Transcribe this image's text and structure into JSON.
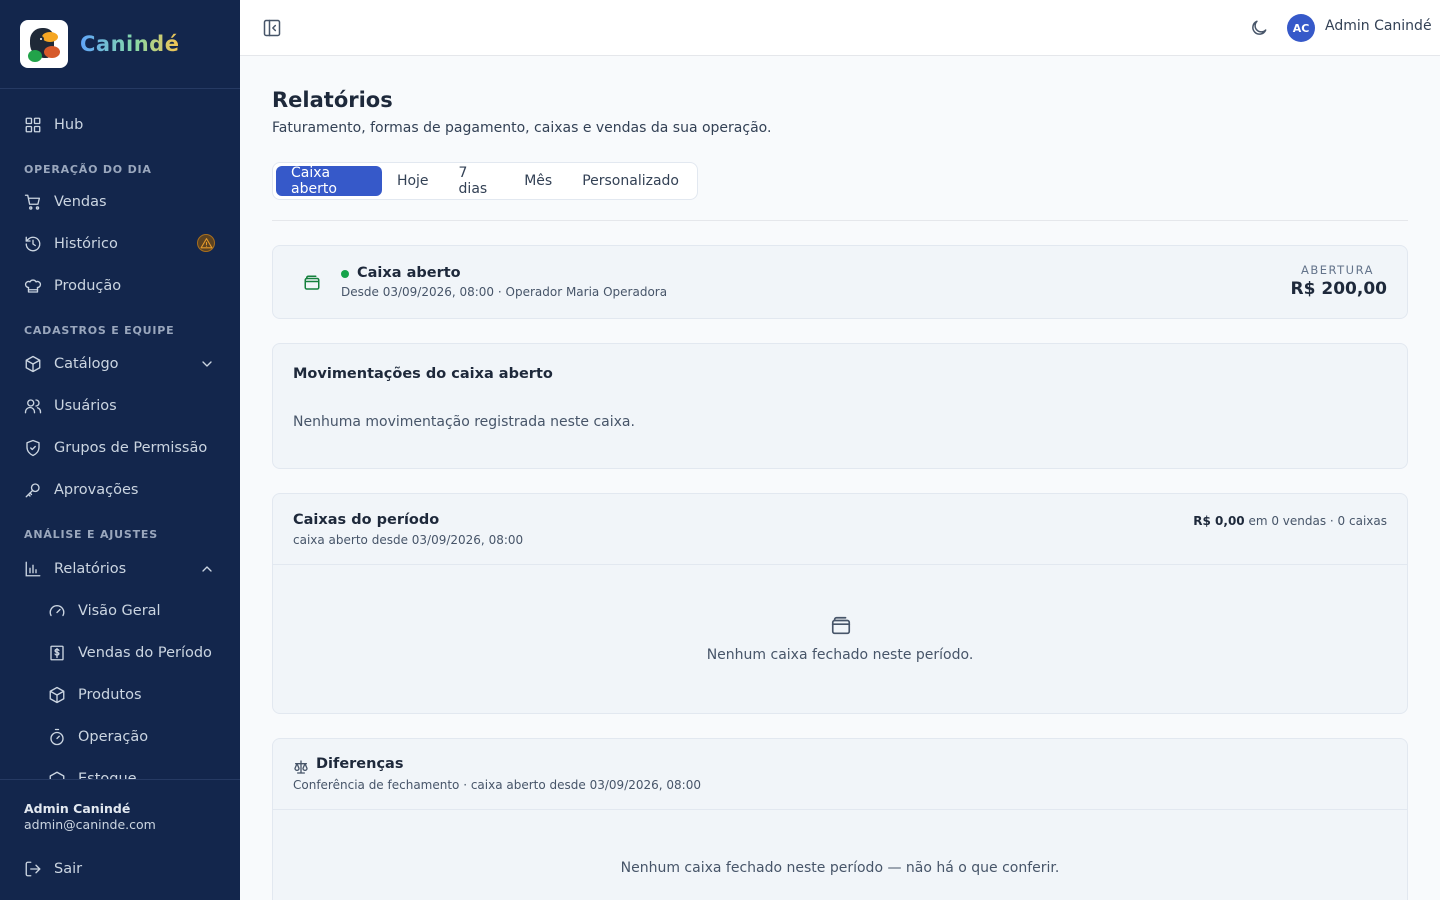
{
  "brand": {
    "name": "Canindé"
  },
  "sidebar": {
    "hub": "Hub",
    "section_operacao": "OPERAÇÃO DO DIA",
    "vendas": "Vendas",
    "historico": "Histórico",
    "producao": "Produção",
    "section_cadastros": "CADASTROS E EQUIPE",
    "catalogo": "Catálogo",
    "usuarios": "Usuários",
    "grupos": "Grupos de Permissão",
    "aprovacoes": "Aprovações",
    "section_analise": "ANÁLISE E AJUSTES",
    "relatorios": "Relatórios",
    "visao_geral": "Visão Geral",
    "vendas_periodo": "Vendas do Período",
    "produtos": "Produtos",
    "operacao": "Operação",
    "estoque": "Estoque",
    "user_name": "Admin Canindé",
    "user_email": "admin@caninde.com",
    "logout": "Sair"
  },
  "topbar": {
    "avatar_initials": "AC",
    "user_name": "Admin Canindé"
  },
  "page": {
    "title": "Relatórios",
    "subtitle": "Faturamento, formas de pagamento, caixas e vendas da sua operação."
  },
  "filters": {
    "options": [
      "Caixa aberto",
      "Hoje",
      "7 dias",
      "Mês",
      "Personalizado"
    ],
    "selected": "Caixa aberto"
  },
  "caixa_card": {
    "title": "Caixa aberto",
    "meta": "Desde 03/09/2026, 08:00 · Operador Maria Operadora",
    "abertura_label": "ABERTURA",
    "abertura_value": "R$ 200,00"
  },
  "movimentacoes": {
    "title": "Movimentações do caixa aberto",
    "empty": "Nenhuma movimentação registrada neste caixa."
  },
  "caixas_periodo": {
    "title": "Caixas do período",
    "subtitle": "caixa aberto desde 03/09/2026, 08:00",
    "summary_value": "R$ 0,00",
    "summary_rest": " em 0 vendas · 0 caixas",
    "empty": "Nenhum caixa fechado neste período."
  },
  "diferencas": {
    "title": "Diferenças",
    "subtitle": "Conferência de fechamento · caixa aberto desde 03/09/2026, 08:00",
    "empty": "Nenhum caixa fechado neste período — não há o que conferir."
  },
  "colors": {
    "sidebar_bg": "#13264c",
    "accent": "#3659c9",
    "status_open": "#16a34a",
    "warning": "#d97706"
  }
}
